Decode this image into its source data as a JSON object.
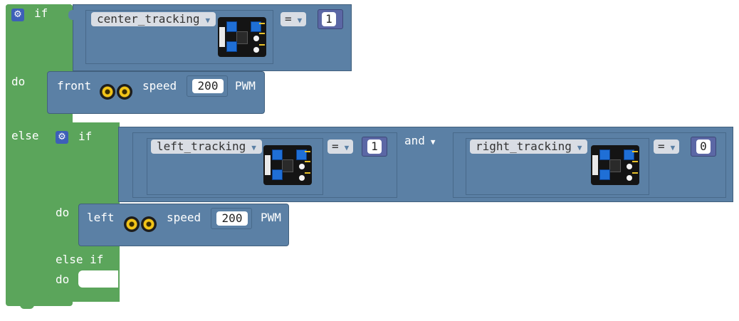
{
  "blocks": {
    "if_outer": {
      "if_label": "if",
      "do_label": "do",
      "else_label": "else",
      "condition": {
        "variable": "center_tracking",
        "operator": "=",
        "value": "1"
      },
      "do_statement": {
        "direction": "front",
        "speed_label": "speed",
        "speed_value": "200",
        "unit": "PWM"
      }
    },
    "if_inner": {
      "if_label": "if",
      "do_label": "do",
      "else_if_label": "else if",
      "do2_label": "do",
      "and_label": "and",
      "left_condition": {
        "variable": "left_tracking",
        "operator": "=",
        "value": "1"
      },
      "right_condition": {
        "variable": "right_tracking",
        "operator": "=",
        "value": "0"
      },
      "do_statement": {
        "direction": "left",
        "speed_label": "speed",
        "speed_value": "200",
        "unit": "PWM"
      }
    }
  },
  "colors": {
    "logic_green": "#5ba55b",
    "sensor_blue": "#5b80a5",
    "number_purple": "#5b67a5"
  },
  "icons": {
    "mutator": "gear-icon",
    "sensor": "tracking-sensor-icon",
    "motor": "motor-wheel-icon"
  }
}
